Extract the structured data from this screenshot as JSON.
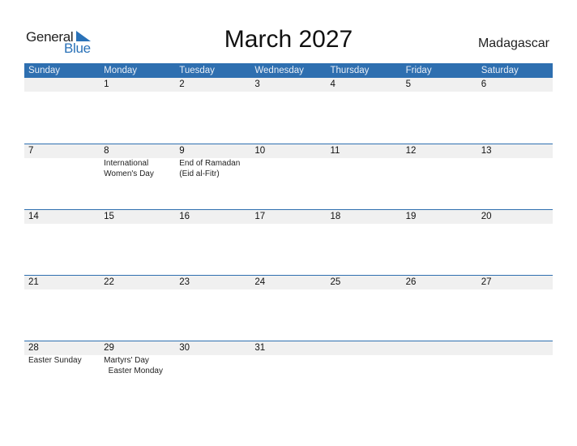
{
  "logo": {
    "line1": "General",
    "line2": "Blue"
  },
  "title": "March 2027",
  "country": "Madagascar",
  "colors": {
    "accent": "#2e6fb0",
    "date_strip": "#f0f0f0"
  },
  "weekdays": [
    "Sunday",
    "Monday",
    "Tuesday",
    "Wednesday",
    "Thursday",
    "Friday",
    "Saturday"
  ],
  "weeks": [
    {
      "days": [
        {
          "num": "",
          "holiday": ""
        },
        {
          "num": "1",
          "holiday": ""
        },
        {
          "num": "2",
          "holiday": ""
        },
        {
          "num": "3",
          "holiday": ""
        },
        {
          "num": "4",
          "holiday": ""
        },
        {
          "num": "5",
          "holiday": ""
        },
        {
          "num": "6",
          "holiday": ""
        }
      ]
    },
    {
      "days": [
        {
          "num": "7",
          "holiday": ""
        },
        {
          "num": "8",
          "holiday": "International\nWomen's Day"
        },
        {
          "num": "9",
          "holiday": "End of Ramadan\n(Eid al-Fitr)"
        },
        {
          "num": "10",
          "holiday": ""
        },
        {
          "num": "11",
          "holiday": ""
        },
        {
          "num": "12",
          "holiday": ""
        },
        {
          "num": "13",
          "holiday": ""
        }
      ]
    },
    {
      "days": [
        {
          "num": "14",
          "holiday": ""
        },
        {
          "num": "15",
          "holiday": ""
        },
        {
          "num": "16",
          "holiday": ""
        },
        {
          "num": "17",
          "holiday": ""
        },
        {
          "num": "18",
          "holiday": ""
        },
        {
          "num": "19",
          "holiday": ""
        },
        {
          "num": "20",
          "holiday": ""
        }
      ]
    },
    {
      "days": [
        {
          "num": "21",
          "holiday": ""
        },
        {
          "num": "22",
          "holiday": ""
        },
        {
          "num": "23",
          "holiday": ""
        },
        {
          "num": "24",
          "holiday": ""
        },
        {
          "num": "25",
          "holiday": ""
        },
        {
          "num": "26",
          "holiday": ""
        },
        {
          "num": "27",
          "holiday": ""
        }
      ]
    },
    {
      "days": [
        {
          "num": "28",
          "holiday": "Easter Sunday"
        },
        {
          "num": "29",
          "holiday": "Martyrs' Day\n  Easter Monday"
        },
        {
          "num": "30",
          "holiday": ""
        },
        {
          "num": "31",
          "holiday": ""
        },
        {
          "num": "",
          "holiday": ""
        },
        {
          "num": "",
          "holiday": ""
        },
        {
          "num": "",
          "holiday": ""
        }
      ]
    }
  ]
}
